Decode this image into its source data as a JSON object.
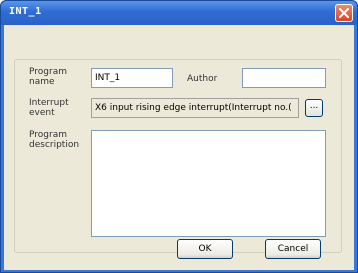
{
  "window": {
    "title": "INT_1"
  },
  "form": {
    "program_name_label": "Program name",
    "program_name_value": "INT_1",
    "author_label": "Author",
    "author_value": "",
    "interrupt_event_label": "Interrupt event",
    "interrupt_event_value": "X6 input rising edge interrupt(Interrupt no.(",
    "browse_label": "...",
    "program_description_label": "Program description",
    "program_description_value": ""
  },
  "buttons": {
    "ok_label": "OK",
    "cancel_label": "Cancel"
  },
  "icons": {
    "close": "close-icon"
  },
  "colors": {
    "title_bar": "#2f6cd2",
    "close_button": "#d8471f",
    "dialog_background": "#ece9d8"
  }
}
